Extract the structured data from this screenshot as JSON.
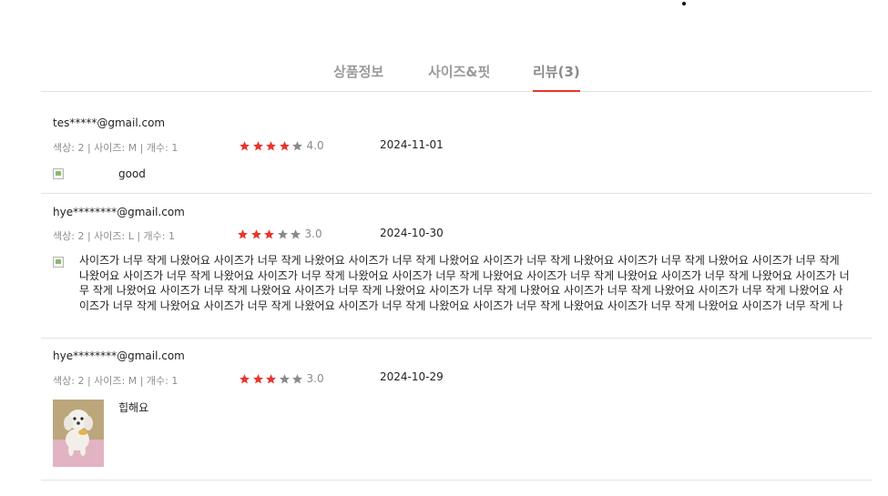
{
  "tabs": [
    {
      "label": "상품정보"
    },
    {
      "label": "사이즈&핏"
    },
    {
      "label": "리뷰(3)"
    }
  ],
  "reviews": [
    {
      "email": "tes*****@gmail.com",
      "meta": "색상: 2 | 사이즈: M | 개수: 1",
      "rating": 4,
      "rating_label": "4.0",
      "date": "2024-11-01",
      "text": "good"
    },
    {
      "email": "hye********@gmail.com",
      "meta": "색상: 2 | 사이즈: L | 개수: 1",
      "rating": 3,
      "rating_label": "3.0",
      "date": "2024-10-30",
      "text": "사이즈가 너무 작게 나왔어요 사이즈가 너무 작게 나왔어요 사이즈가 너무 작게 나왔어요 사이즈가 너무 작게 나왔어요 사이즈가 너무 작게 나왔어요 사이즈가 너무 작게 나왔어요 사이즈가 너무 작게 나왔어요 사이즈가 너무 작게 나왔어요 사이즈가 너무 작게 나왔어요 사이즈가 너무 작게 나왔어요 사이즈가 너무 작게 나왔어요 사이즈가 너무 작게 나왔어요 사이즈가 너무 작게 나왔어요 사이즈가 너무 작게 나왔어요 사이즈가 너무 작게 나왔어요 사이즈가 너무 작게 나왔어요 사이즈가 너무 작게 나왔어요 사이즈가 너무 작게 나왔어요 사이즈가 너무 작게 나왔어요 사이즈가 너무 작게 나왔어요 사이즈가 너무 작게 나왔어요 사이즈가 너무 작게 나왔어요 사이즈가 너무 작게 나왔어요 사이즈가 너무 작게 나왔어요 사이즈가 너..."
    },
    {
      "email": "hye********@gmail.com",
      "meta": "색상: 2 | 사이즈: M | 개수: 1",
      "rating": 3,
      "rating_label": "3.0",
      "date": "2024-10-29",
      "text": "힙해요"
    }
  ],
  "colors": {
    "accent": "#e8352b",
    "star_off": "#8a8a8a",
    "divider": "#e3e3e3"
  }
}
